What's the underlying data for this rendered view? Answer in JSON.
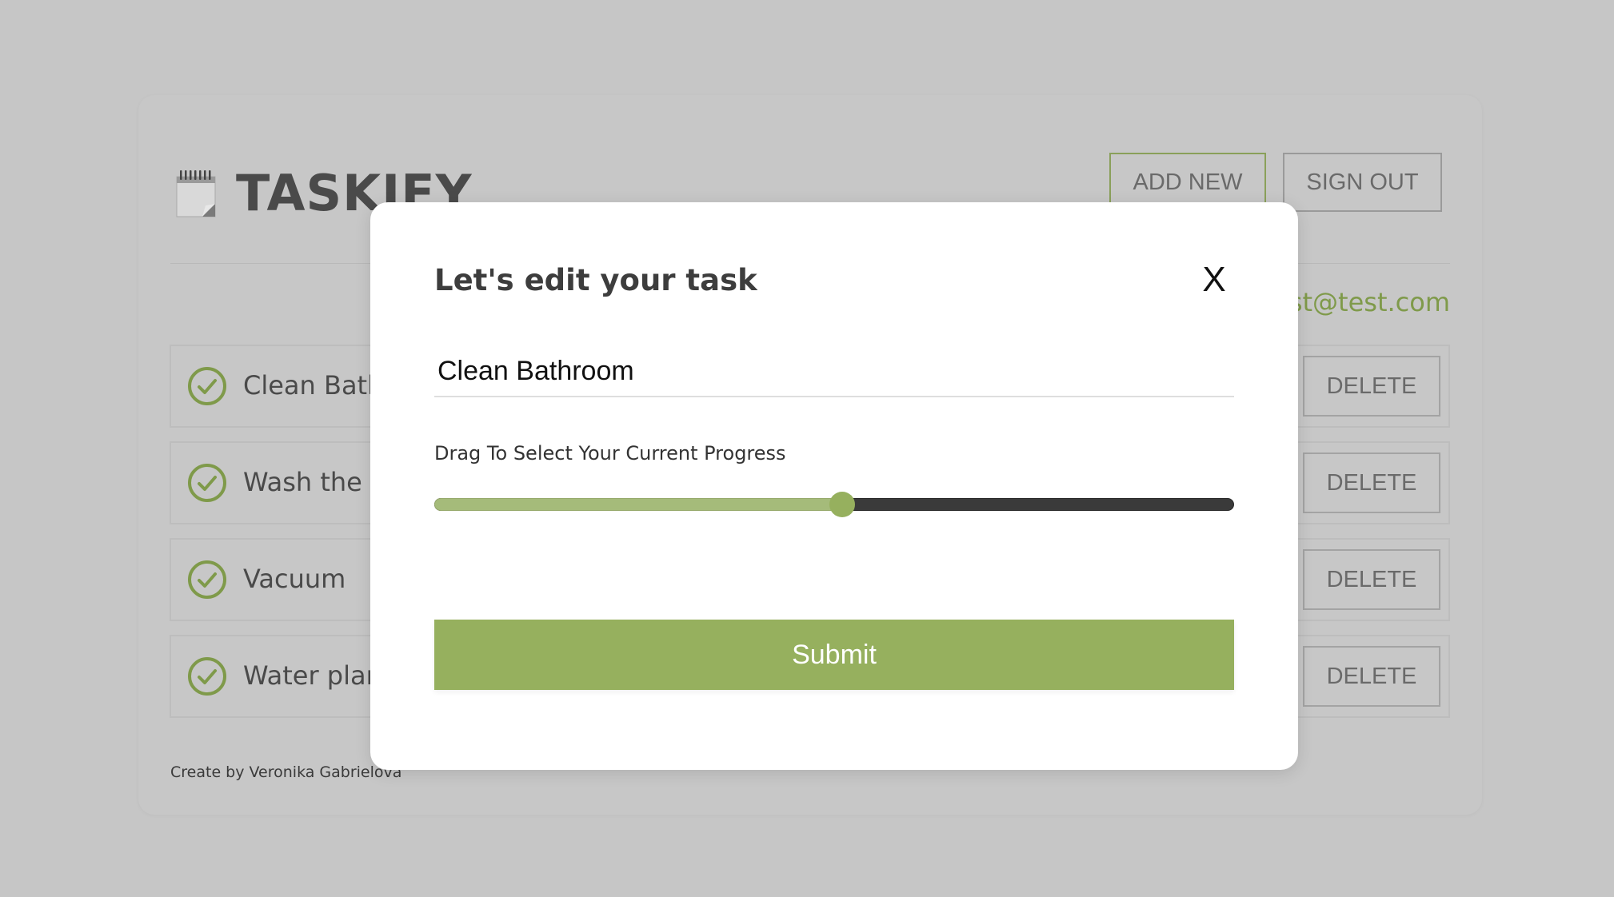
{
  "app": {
    "title": "TASKIFY",
    "logo_icon": "notepad-icon",
    "add_new_label": "ADD NEW",
    "sign_out_label": "SIGN OUT",
    "user_email": "test@test.com",
    "footer_credit": "Create by Veronika Gabrielova"
  },
  "tasks": [
    {
      "name": "Clean Bathroom",
      "delete_label": "DELETE",
      "icon": "check-circle-icon"
    },
    {
      "name": "Wash the clothes",
      "delete_label": "DELETE",
      "icon": "check-circle-icon"
    },
    {
      "name": "Vacuum",
      "delete_label": "DELETE",
      "icon": "check-circle-icon"
    },
    {
      "name": "Water plants",
      "delete_label": "DELETE",
      "icon": "check-circle-icon"
    }
  ],
  "modal": {
    "title": "Let's edit your task",
    "close_label": "X",
    "task_value": "Clean Bathroom",
    "slider_label": "Drag To Select Your Current Progress",
    "progress_percent": 51,
    "submit_label": "Submit"
  },
  "colors": {
    "accent": "#96b05e",
    "email": "#7f9a4a",
    "overlay_bg": "#c6c6c6"
  }
}
